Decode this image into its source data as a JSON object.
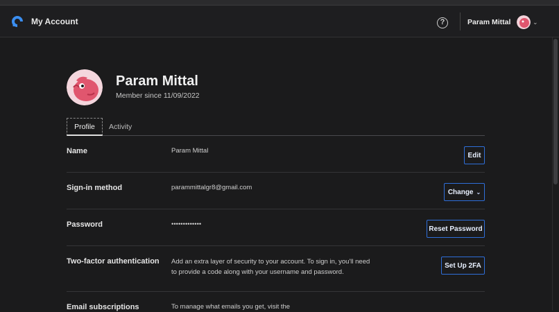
{
  "header": {
    "app_title": "My Account",
    "help_glyph": "?",
    "user_name": "Param Mittal",
    "chevron": "⌄"
  },
  "profile": {
    "name": "Param Mittal",
    "member_since": "Member since 11/09/2022"
  },
  "tabs": [
    {
      "label": "Profile",
      "active": true
    },
    {
      "label": "Activity",
      "active": false
    }
  ],
  "rows": {
    "name": {
      "label": "Name",
      "value": "Param Mittal",
      "button": "Edit"
    },
    "signin": {
      "label": "Sign-in method",
      "value": "parammittalgr8@gmail.com",
      "button": "Change",
      "button_chevron": "⌄"
    },
    "password": {
      "label": "Password",
      "value": "•••••••••••••",
      "button": "Reset Password"
    },
    "twofa": {
      "label": "Two-factor authentication",
      "value_line1": "Add an extra layer of security to your account. To sign in, you'll need",
      "value_line2": "to provide a code along with your username and password.",
      "button": "Set Up 2FA"
    },
    "email": {
      "label": "Email subscriptions",
      "value": "To manage what emails you get, visit the"
    }
  },
  "colors": {
    "background": "#1b1b1c",
    "accent": "#2f6fda",
    "avatar_pink": "#e0566e"
  }
}
